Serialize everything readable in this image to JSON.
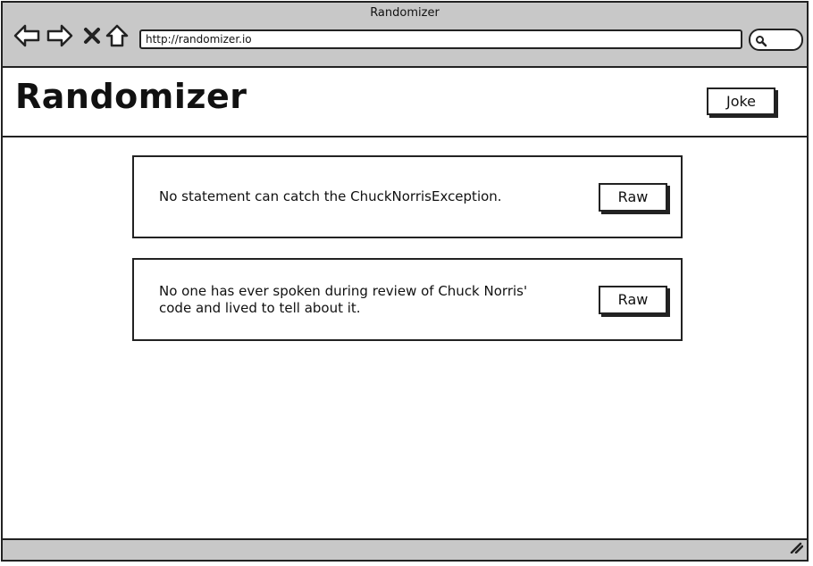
{
  "window": {
    "title": "Randomizer"
  },
  "browser": {
    "url": "http://randomizer.io",
    "icons": [
      "back-arrow-icon",
      "forward-arrow-icon",
      "close-icon",
      "home-icon",
      "search-icon"
    ]
  },
  "header": {
    "title": "Randomizer",
    "joke_button_label": "Joke"
  },
  "jokes": [
    {
      "text": "No statement can catch the ChuckNorrisException.",
      "button_label": "Raw"
    },
    {
      "text": "No one has ever spoken during review of Chuck Norris' code and lived to tell about it.",
      "button_label": "Raw"
    }
  ],
  "colors": {
    "chrome": "#c8c8c8",
    "border": "#222222",
    "background": "#ffffff"
  }
}
